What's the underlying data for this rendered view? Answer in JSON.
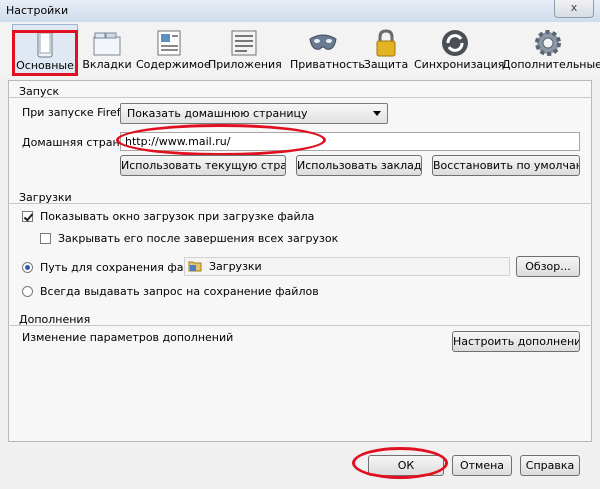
{
  "window": {
    "title": "Настройки",
    "close_label": "x"
  },
  "tabs": [
    {
      "label": "Основные",
      "icon": "switch-icon"
    },
    {
      "label": "Вкладки",
      "icon": "tabs-icon"
    },
    {
      "label": "Содержимое",
      "icon": "content-icon"
    },
    {
      "label": "Приложения",
      "icon": "applications-icon"
    },
    {
      "label": "Приватность",
      "icon": "mask-icon"
    },
    {
      "label": "Защита",
      "icon": "lock-icon"
    },
    {
      "label": "Синхронизация",
      "icon": "sync-icon"
    },
    {
      "label": "Дополнительные",
      "icon": "gear-icon"
    }
  ],
  "startup": {
    "title": "Запуск",
    "on_start_label": "При запуске Firefox:",
    "on_start_value": "Показать домашнюю страницу",
    "homepage_label": "Домашняя страница:",
    "homepage_value": "http://www.mail.ru/",
    "use_current_label": "Использовать текущую страницу",
    "use_bookmark_label": "Использовать закладку...",
    "restore_default_label": "Восстановить по умолчанию"
  },
  "downloads": {
    "title": "Загрузки",
    "show_window_label": "Показывать окно загрузок при загрузке файла",
    "show_window_checked": true,
    "close_after_label": "Закрывать его после завершения всех загрузок",
    "close_after_checked": false,
    "save_path_label": "Путь для сохранения файлов",
    "save_path_value": "Загрузки",
    "browse_label": "Обзор...",
    "always_ask_label": "Всегда выдавать запрос на сохранение файлов"
  },
  "addons": {
    "title": "Дополнения",
    "description": "Изменение параметров дополнений",
    "configure_label": "Настроить дополнения..."
  },
  "footer": {
    "ok_label": "ОК",
    "cancel_label": "Отмена",
    "help_label": "Справка"
  },
  "colors": {
    "highlight_red": "#e01020",
    "selected_tab": "#dfe8f3"
  }
}
